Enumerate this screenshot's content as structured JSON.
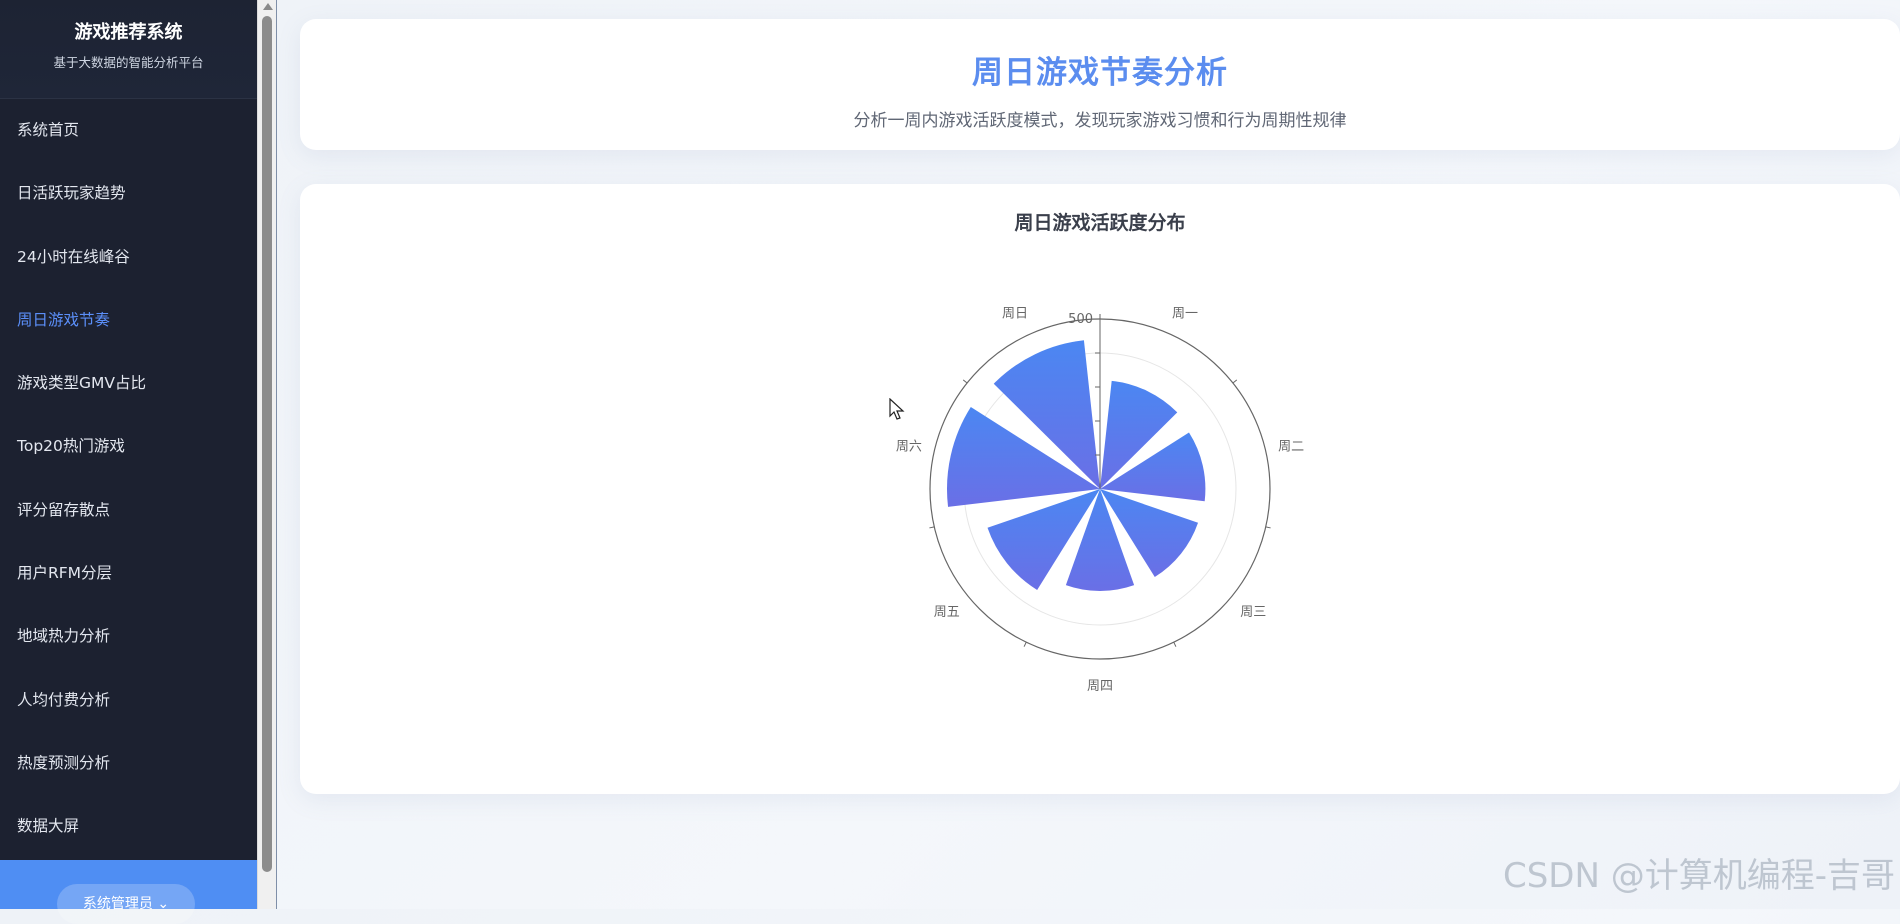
{
  "sidebar": {
    "brand_title": "游戏推荐系统",
    "brand_subtitle": "基于大数据的智能分析平台",
    "items": [
      {
        "label": "系统首页"
      },
      {
        "label": "日活跃玩家趋势"
      },
      {
        "label": "24小时在线峰谷"
      },
      {
        "label": "周日游戏节奏"
      },
      {
        "label": "游戏类型GMV占比"
      },
      {
        "label": "Top20热门游戏"
      },
      {
        "label": "评分留存散点"
      },
      {
        "label": "用户RFM分层"
      },
      {
        "label": "地域热力分析"
      },
      {
        "label": "人均付费分析"
      },
      {
        "label": "热度预测分析"
      },
      {
        "label": "数据大屏"
      }
    ],
    "active_index": 3,
    "user_label": "系统管理员 ⌄"
  },
  "header": {
    "title": "周日游戏节奏分析",
    "description": "分析一周内游戏活跃度模式，发现玩家游戏习惯和行为周期性规律"
  },
  "chart_data": {
    "type": "polar-bar",
    "title": "周日游戏活跃度分布",
    "categories": [
      "周一",
      "周二",
      "周三",
      "周四",
      "周五",
      "周六",
      "周日"
    ],
    "values": [
      320,
      310,
      305,
      300,
      350,
      450,
      440
    ],
    "radial_max": 500,
    "radial_tick_labels": [
      "500"
    ],
    "colors": {
      "bar_top": "#4b87f2",
      "bar_bottom": "#6a6fe6",
      "axis": "#666666",
      "grid": "#e6e6e6"
    }
  },
  "watermark": "CSDN @计算机编程-吉哥"
}
